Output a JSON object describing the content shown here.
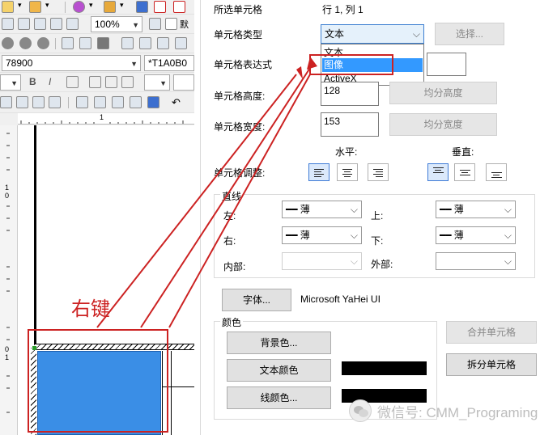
{
  "toolbar": {
    "zoom": "100%",
    "font_size": "78900",
    "title": "*T1A0B0",
    "bold": "B",
    "italic": "I",
    "ruler_mark": "1"
  },
  "ruler": {
    "v_labels": [
      "1",
      "0",
      "0",
      "1"
    ]
  },
  "annotation": {
    "text": "右键"
  },
  "dialog": {
    "selected_cell_label": "所选单元格",
    "selected_cell_value": "行 1, 列 1",
    "cell_type_label": "单元格类型",
    "cell_type_value": "文本",
    "cell_type_options": [
      "文本",
      "图像",
      "ActiveX"
    ],
    "cell_type_highlight": 1,
    "select_button": "选择...",
    "expression_label": "单元格表达式",
    "height_label": "单元格高度:",
    "height_value": "128",
    "equal_height": "均分高度",
    "width_label": "单元格宽度:",
    "width_value": "153",
    "equal_width": "均分宽度",
    "align_label": "单元格调整:",
    "horizontal_label": "水平:",
    "vertical_label": "垂直:",
    "lines": {
      "group_label": "直线",
      "left_label": "左:",
      "left_value": "薄",
      "top_label": "上:",
      "top_value": "薄",
      "right_label": "右:",
      "right_value": "薄",
      "bottom_label": "下:",
      "bottom_value": "薄",
      "inner_label": "内部:",
      "inner_value": "",
      "outer_label": "外部:",
      "outer_value": ""
    },
    "font_button": "字体...",
    "font_name": "Microsoft YaHei UI",
    "colors": {
      "group_label": "颜色",
      "background_button": "背景色...",
      "text_color_button": "文本颜色",
      "line_color_button": "线颜色...",
      "swatch_color": "#000000"
    },
    "merge_button": "合并单元格",
    "split_button": "拆分单元格"
  },
  "watermark": {
    "text": "微信号: CMM_Programing"
  },
  "colors": {
    "accent": "#3399ff",
    "annotation_red": "#cc2222",
    "cell_fill": "#3a8ee6"
  }
}
